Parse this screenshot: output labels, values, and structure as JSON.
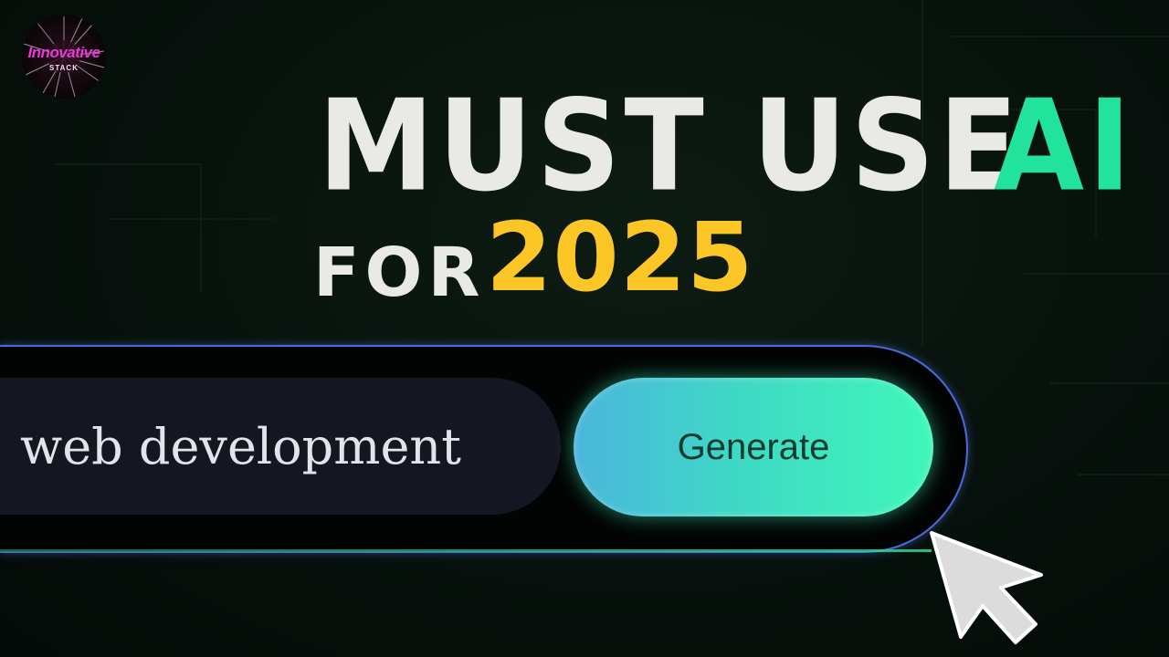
{
  "logo": {
    "name": "Innovative",
    "sub": "STACK"
  },
  "headline": {
    "line1": "MUST USE",
    "highlight": "AI",
    "line2_prefix": "FOR",
    "year": "2025"
  },
  "search": {
    "input_value": "web development",
    "button_label": "Generate"
  },
  "colors": {
    "background": "#07110c",
    "headline_text": "#e9e9e6",
    "ai_accent": "#22e39b",
    "year_accent": "#fcc626",
    "bar_border": "#4a6bd8",
    "input_bg": "#151621",
    "button_gradient_start": "#4ab6dc",
    "button_gradient_end": "#3ff7b8",
    "logo_text": "#e73bd6"
  },
  "icons": {
    "cursor": "mouse-pointer-arrow-icon"
  }
}
